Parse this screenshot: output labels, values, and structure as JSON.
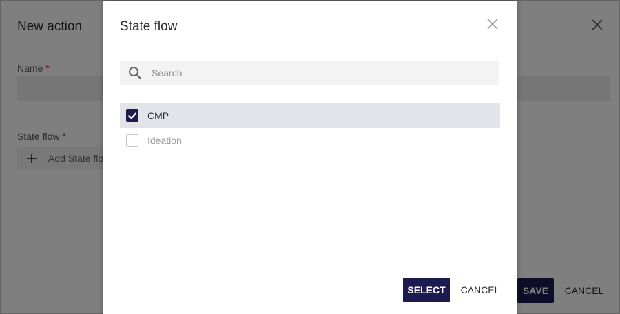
{
  "background": {
    "title": "New action",
    "name_label": "Name",
    "required_mark": "*",
    "state_flow_label": "State flow",
    "add_state_flow_label": "Add State flow",
    "save_label": "SAVE",
    "cancel_label": "CANCEL"
  },
  "dialog": {
    "title": "State flow",
    "search": {
      "placeholder": "Search",
      "value": ""
    },
    "options": [
      {
        "label": "CMP",
        "checked": true
      },
      {
        "label": "Ideation",
        "checked": false
      }
    ],
    "select_label": "SELECT",
    "cancel_label": "CANCEL"
  },
  "colors": {
    "primary": "#1b1b4f",
    "required": "#c0392b",
    "selected_row": "#e3e3ea",
    "field_bg": "#f3f3f3"
  },
  "icons": [
    "close-icon",
    "search-icon",
    "plus-icon",
    "checkbox-checked",
    "checkbox-unchecked"
  ]
}
